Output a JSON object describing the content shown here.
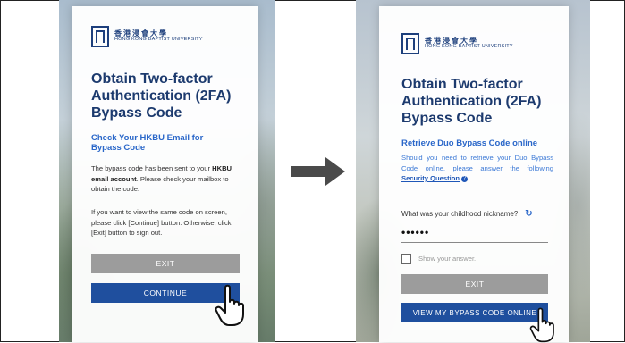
{
  "left_panel": {
    "logo": {
      "cn": "香港浸會大學",
      "en": "HONG KONG BAPTIST UNIVERSITY"
    },
    "title": [
      "Obtain Two-factor",
      "Authentication (2FA)",
      "Bypass Code"
    ],
    "subtitle": [
      "Check Your HKBU Email for",
      "Bypass Code"
    ],
    "para1": {
      "before": "The bypass code has been sent to your",
      "bold": "HKBU email account",
      "after": ". Please check your mailbox to obtain the code."
    },
    "para2": "If you want to view the same code on screen, please click [Continue] button. Otherwise, click [Exit] button to sign out.",
    "exit_label": "EXIT",
    "continue_label": "CONTINUE"
  },
  "right_panel": {
    "logo": {
      "cn": "香港浸會大學",
      "en": "HONG KONG BAPTIST UNIVERSITY"
    },
    "title": [
      "Obtain Two-factor",
      "Authentication (2FA)",
      "Bypass Code"
    ],
    "subtitle": "Retrieve Duo Bypass Code online",
    "instructions_before": "Should you need to retrieve your Duo Bypass Code online, please answer the following",
    "instructions_link": "Security Question",
    "question": "What was your childhood nickname?",
    "answer_masked": "••••••",
    "show_answer_label": "Show your answer.",
    "exit_label": "EXIT",
    "view_label": "VIEW MY BYPASS CODE ONLINE"
  },
  "colors": {
    "title": "#1c3a6e",
    "accent_blue": "#2a67c9",
    "button_primary": "#1f4f9e",
    "button_exit": "#9c9c9c",
    "arrow": "#4a4a4a"
  },
  "icons": [
    "hkbu-logo-icon",
    "arrow-right-icon",
    "pointer-hand-icon",
    "refresh-icon",
    "info-icon"
  ]
}
